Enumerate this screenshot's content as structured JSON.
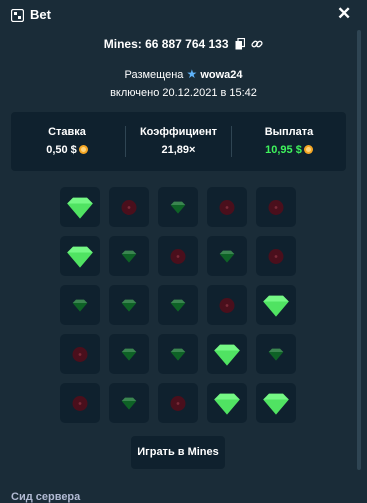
{
  "header": {
    "title": "Bet",
    "close_symbol": "✕"
  },
  "bet": {
    "game_id_label": "Mines: 66 887 764 133",
    "placed_by_prefix": "Размещена",
    "username": "wowa24",
    "date_text": "включено 20.12.2021 в 15:42"
  },
  "stats": {
    "bet_label": "Ставка",
    "bet_value": "0,50 $",
    "multiplier_label": "Коэффициент",
    "multiplier_value": "21,89×",
    "payout_label": "Выплата",
    "payout_value": "10,95 $"
  },
  "board": {
    "rows": [
      [
        "gem_revealed",
        "mine",
        "gem",
        "mine",
        "mine"
      ],
      [
        "gem_revealed",
        "gem",
        "mine",
        "gem",
        "mine"
      ],
      [
        "gem",
        "gem",
        "gem",
        "mine",
        "gem_revealed"
      ],
      [
        "mine",
        "gem",
        "gem",
        "gem_revealed",
        "gem"
      ],
      [
        "mine",
        "gem",
        "mine",
        "gem_revealed",
        "gem_revealed"
      ]
    ]
  },
  "play_button_label": "Играть в Mines",
  "seed_label": "Сид сервера",
  "colors": {
    "background": "#1a2c38",
    "panel": "#0f212e",
    "gem_bright": "#57f76b",
    "gem_dim": "#106b2a",
    "mine_dim": "#4a0f1c",
    "payout_green": "#3ff35c"
  }
}
